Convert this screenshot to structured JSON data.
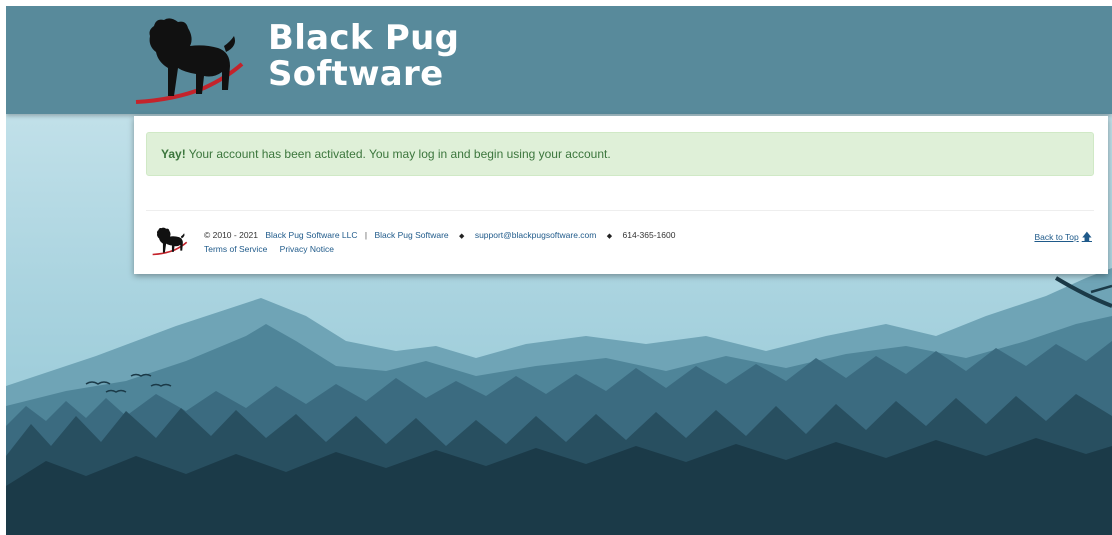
{
  "header": {
    "brand_line1": "Black Pug",
    "brand_line2": "Software"
  },
  "alert": {
    "strong": "Yay!",
    "message": " Your account has been activated. You may log in and begin using your account."
  },
  "footer": {
    "copyright": "© 2010 - 2021",
    "company_link": "Black Pug Software LLC",
    "separator": "|",
    "brand_link": "Black Pug Software",
    "email_link": "support@blackpugsoftware.com",
    "phone": "614-365-1600",
    "terms_link": "Terms of Service",
    "privacy_link": "Privacy Notice",
    "back_to_top": "Back to Top"
  },
  "colors": {
    "header_bg": "#588a9b",
    "alert_bg": "#dff0d8",
    "alert_text": "#3c763d",
    "link": "#1f5a8a"
  },
  "icons": {
    "logo": "pug-logo-icon",
    "back_to_top": "arrow-up-icon"
  }
}
